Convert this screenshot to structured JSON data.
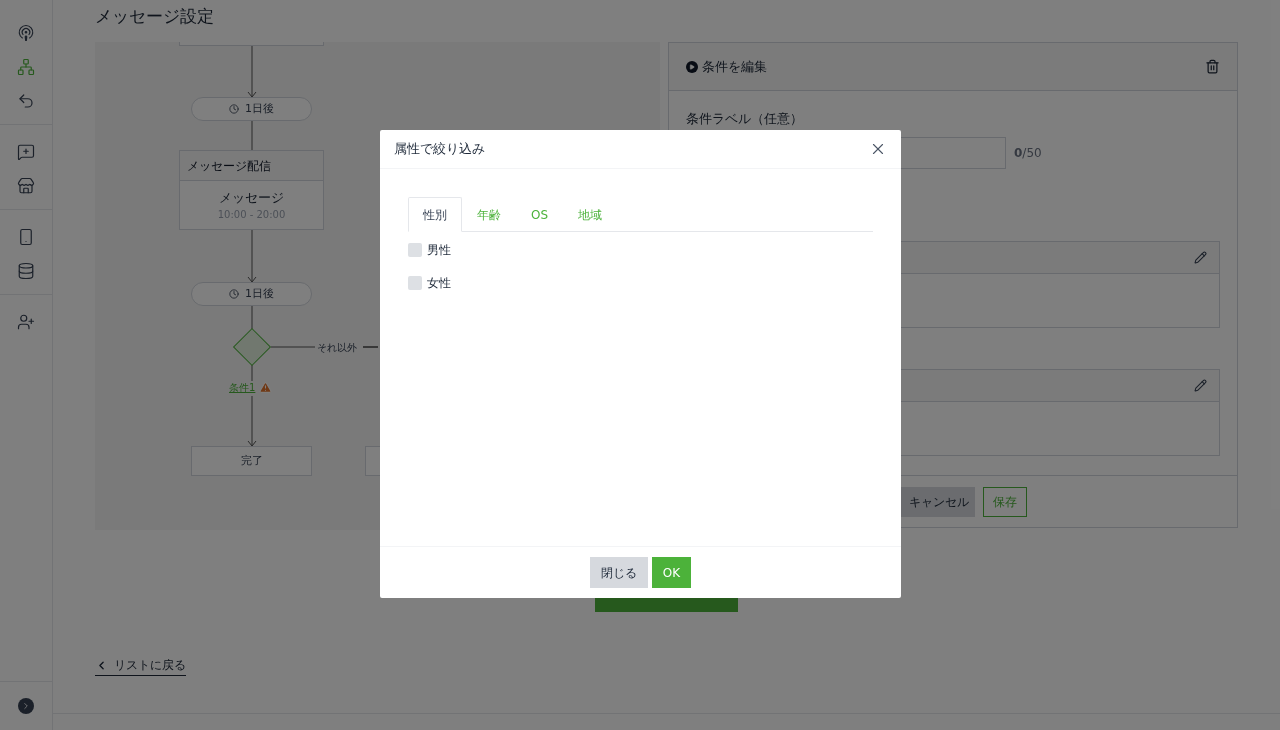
{
  "sidebar": {
    "groups": [
      [
        {
          "selected": false
        },
        {
          "selected": true
        },
        {
          "selected": false
        }
      ],
      [
        {
          "selected": false
        },
        {
          "selected": false
        }
      ],
      [
        {
          "selected": false
        },
        {
          "selected": false
        }
      ],
      [
        {
          "selected": false
        }
      ]
    ]
  },
  "page": {
    "title": "メッセージ設定"
  },
  "flow": {
    "wait_1": "1日後",
    "message_node": {
      "header": "メッセージ配信",
      "title": "メッセージ",
      "time": "10:00 - 20:00"
    },
    "wait_2": "1日後",
    "otherwise_label": "それ以外",
    "condition_link": "条件1",
    "end_node": "完了"
  },
  "condition_panel": {
    "title": "条件を編集",
    "label_field": {
      "label": "条件ラベル（任意）",
      "counter": "**0**/50"
    },
    "cancel_button": "キャンセル",
    "save_button": "保存"
  },
  "back_link": "リストに戻る",
  "modal": {
    "title": "属性で絞り込み",
    "tabs": [
      {
        "label": "性別",
        "selected": true
      },
      {
        "label": "年齢",
        "selected": false
      },
      {
        "label": "OS",
        "selected": false
      },
      {
        "label": "地域",
        "selected": false
      }
    ],
    "options": [
      {
        "label": "男性",
        "checked": false
      },
      {
        "label": "女性",
        "checked": false
      }
    ],
    "buttons": {
      "close": "閉じる",
      "ok": "OK"
    }
  }
}
